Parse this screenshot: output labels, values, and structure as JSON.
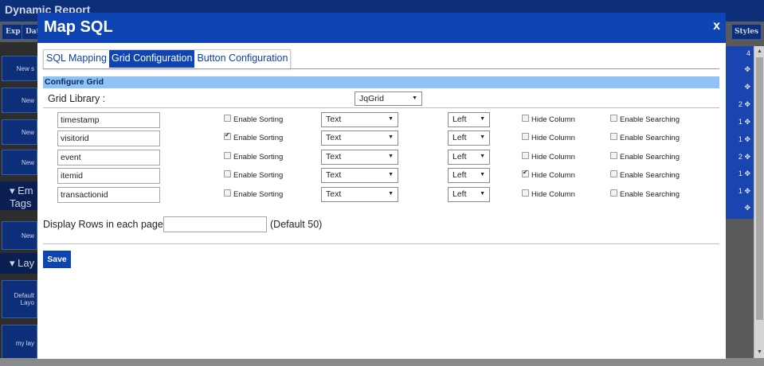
{
  "background": {
    "app_title": "Dynamic Report",
    "toolbar": [
      "Exp",
      "Dat"
    ],
    "styles_button": "Styles",
    "left_items": [
      "New s",
      "New",
      "New",
      "New",
      "New",
      "Default Layo",
      "my lay"
    ],
    "sections": [
      "Em Tags",
      "Lay"
    ],
    "right_rows": [
      "4",
      "",
      "",
      "2",
      "1",
      "1",
      "2",
      "1",
      "1",
      ""
    ],
    "move_icon": "✥"
  },
  "modal": {
    "title": "Map SQL",
    "close_label": "x",
    "tabs": [
      {
        "label": "SQL Mapping",
        "active": false
      },
      {
        "label": "Grid Configuration",
        "active": true
      },
      {
        "label": "Button Configuration",
        "active": false
      }
    ],
    "section_title": "Configure Grid",
    "grid_library_label": "Grid Library :",
    "grid_library_value": "JqGrid",
    "columns": [
      {
        "name": "timestamp",
        "sorting": false,
        "sorting_label": "Enable Sorting",
        "type": "Text",
        "align": "Left",
        "hide": false,
        "hide_label": "Hide Column",
        "searching": false,
        "searching_label": "Enable Searching"
      },
      {
        "name": "visitorid",
        "sorting": true,
        "sorting_label": "Enable Sorting",
        "type": "Text",
        "align": "Left",
        "hide": false,
        "hide_label": "Hide Column",
        "searching": false,
        "searching_label": "Enable Searching"
      },
      {
        "name": "event",
        "sorting": false,
        "sorting_label": "Enable Sorting",
        "type": "Text",
        "align": "Left",
        "hide": false,
        "hide_label": "Hide Column",
        "searching": false,
        "searching_label": "Enable Searching"
      },
      {
        "name": "itemid",
        "sorting": false,
        "sorting_label": "Enable Sorting",
        "type": "Text",
        "align": "Left",
        "hide": true,
        "hide_label": "Hide Column",
        "searching": false,
        "searching_label": "Enable Searching"
      },
      {
        "name": "transactionid",
        "sorting": false,
        "sorting_label": "Enable Sorting",
        "type": "Text",
        "align": "Left",
        "hide": false,
        "hide_label": "Hide Column",
        "searching": false,
        "searching_label": "Enable Searching"
      }
    ],
    "rows_label": "Display Rows in each page:",
    "rows_value": "",
    "rows_default": "(Default 50)",
    "save_label": "Save"
  }
}
